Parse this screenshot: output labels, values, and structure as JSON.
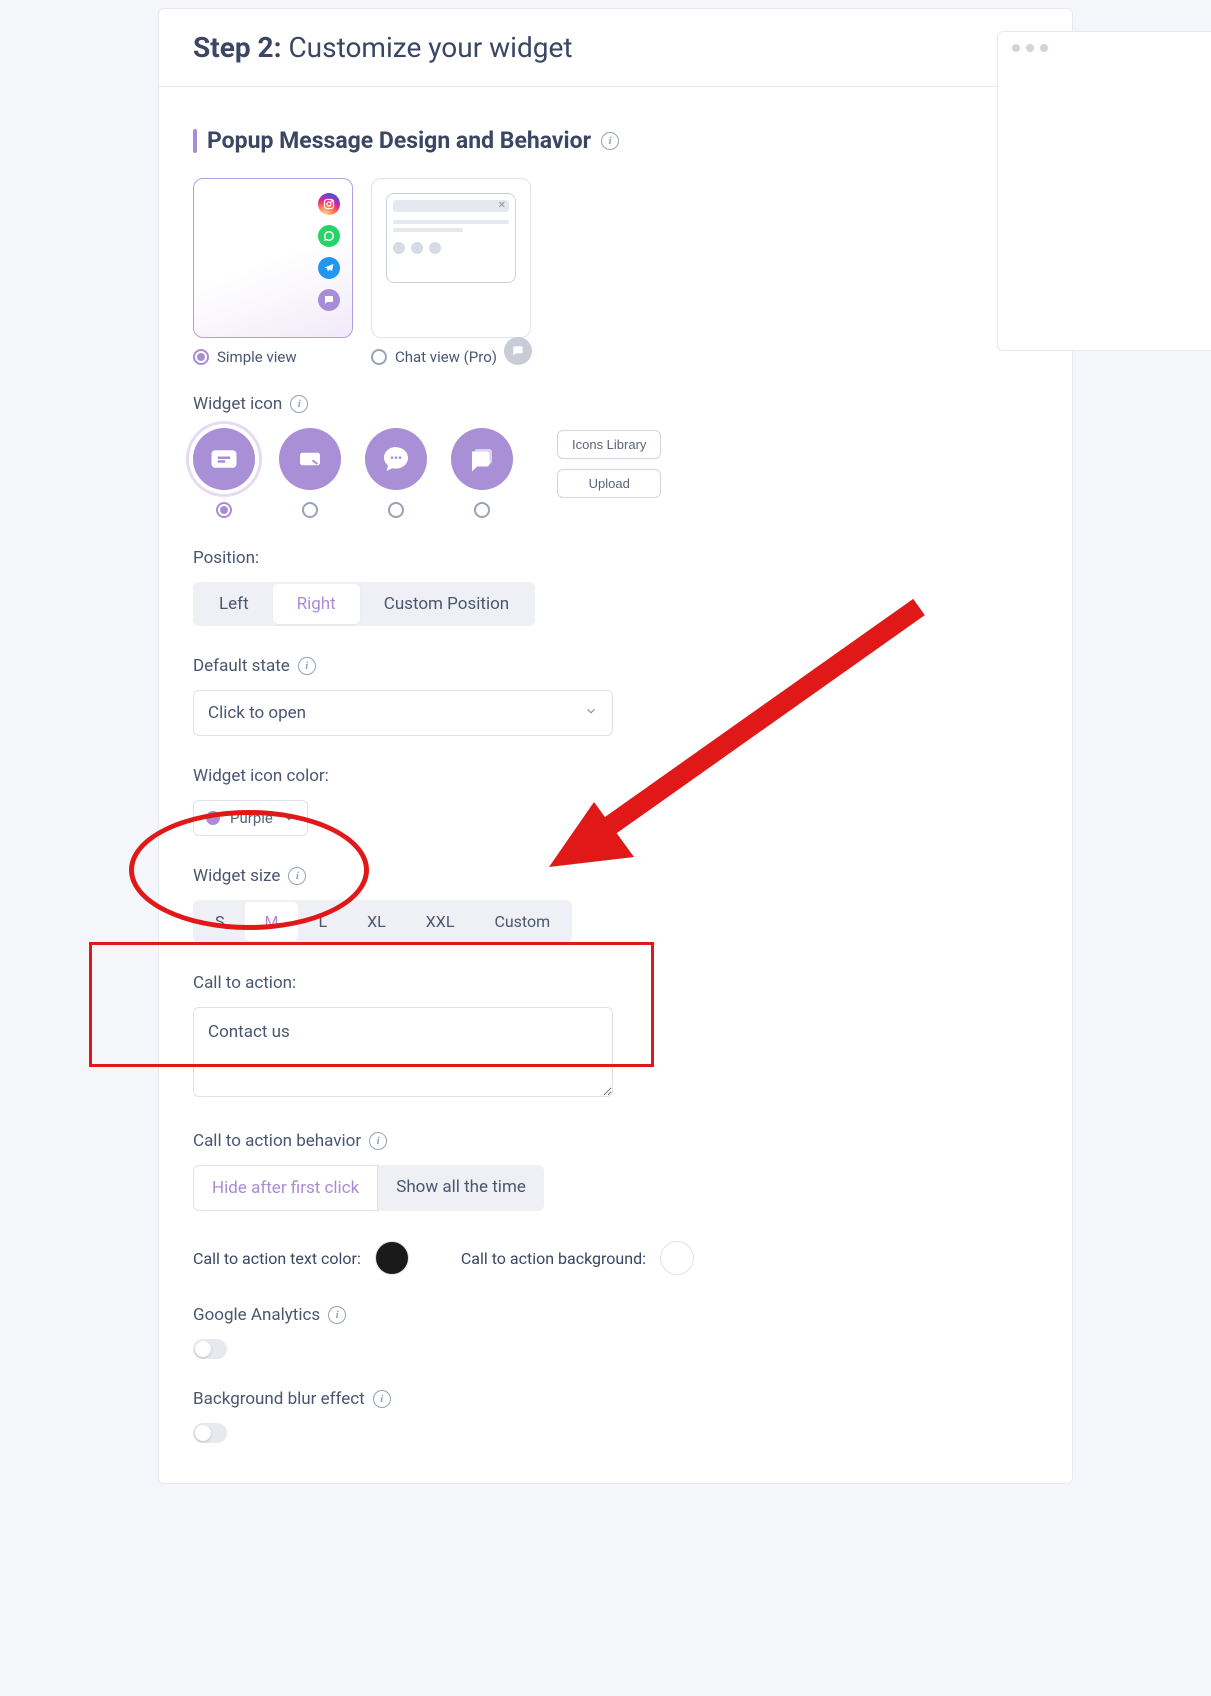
{
  "step": {
    "prefix": "Step 2:",
    "title": "Customize your widget"
  },
  "section_title": "Popup Message Design and Behavior",
  "view_options": {
    "simple_label": "Simple view",
    "chat_label": "Chat view (Pro)",
    "selected": "simple"
  },
  "widget_icon": {
    "label": "Widget icon",
    "icons_library_btn": "Icons Library",
    "upload_btn": "Upload",
    "selected_index": 0
  },
  "position": {
    "label": "Position:",
    "options": [
      "Left",
      "Right",
      "Custom Position"
    ],
    "selected": "Right"
  },
  "default_state": {
    "label": "Default state",
    "value": "Click to open"
  },
  "icon_color": {
    "label": "Widget icon color:",
    "name": "Purple",
    "hex": "#a98cd6"
  },
  "widget_size": {
    "label": "Widget size",
    "options": [
      "S",
      "M",
      "L",
      "XL",
      "XXL",
      "Custom"
    ],
    "selected": "M"
  },
  "cta": {
    "label": "Call to action:",
    "value": "Contact us"
  },
  "cta_behavior": {
    "label": "Call to action behavior",
    "options": [
      "Hide after first click",
      "Show all the time"
    ],
    "selected": "Hide after first click"
  },
  "cta_colors": {
    "text_label": "Call to action text color:",
    "text_hex": "#1a1a1a",
    "bg_label": "Call to action background:",
    "bg_hex": "#ffffff"
  },
  "google_analytics": {
    "label": "Google Analytics",
    "enabled": false
  },
  "bg_blur": {
    "label": "Background blur effect",
    "enabled": false
  },
  "simple_view_icons": [
    {
      "name": "instagram",
      "bg": "linear-gradient(45deg,#f09433,#e6683c,#dc2743,#cc2366,#bc1888)"
    },
    {
      "name": "whatsapp",
      "bg": "#25d366"
    },
    {
      "name": "telegram",
      "bg": "#2196f3"
    },
    {
      "name": "chat",
      "bg": "#a98cd6"
    }
  ]
}
